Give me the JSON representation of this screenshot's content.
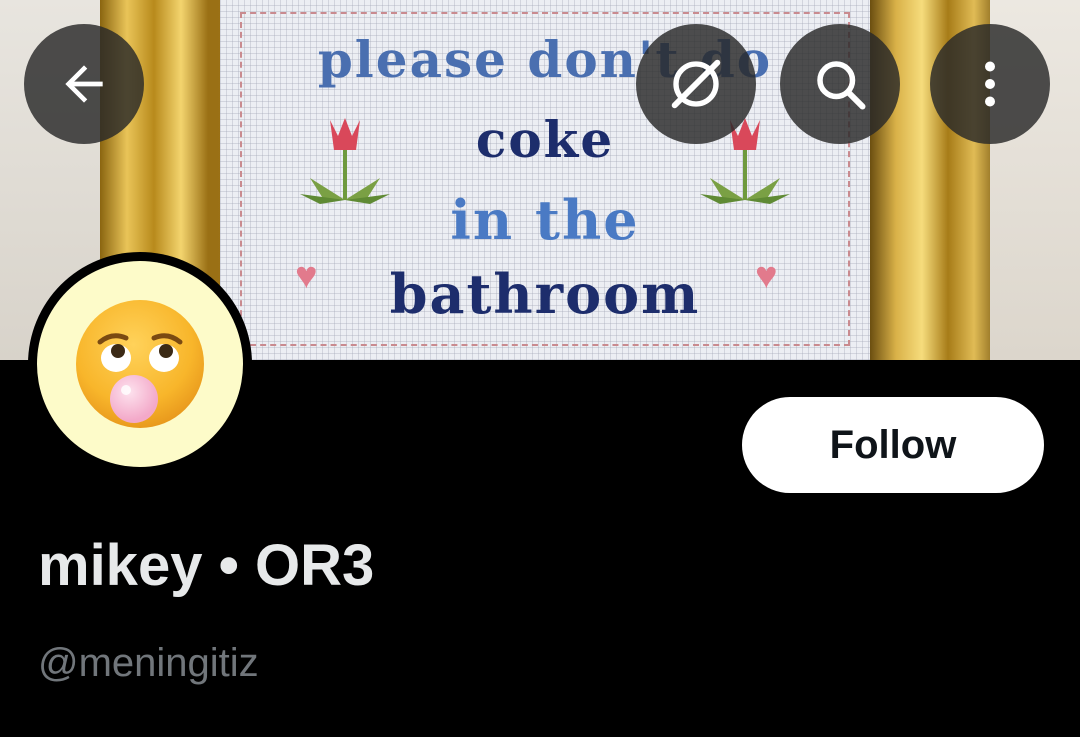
{
  "header": {
    "back_icon": "arrow-left-icon",
    "grok_icon": "grok-slash-circle-icon",
    "search_icon": "search-icon",
    "more_icon": "more-vertical-icon"
  },
  "banner": {
    "stitch_lines": [
      "please don't do",
      "coke",
      "in the",
      "bathroom"
    ]
  },
  "profile": {
    "avatar_icon": "face-with-bubblegum-emoji",
    "follow_label": "Follow",
    "display_name": "mikey • OR3",
    "handle": "@meningitiz"
  },
  "colors": {
    "background": "#000000",
    "follow_bg": "#ffffff",
    "name": "#e7e9ea",
    "handle": "#71767b"
  }
}
